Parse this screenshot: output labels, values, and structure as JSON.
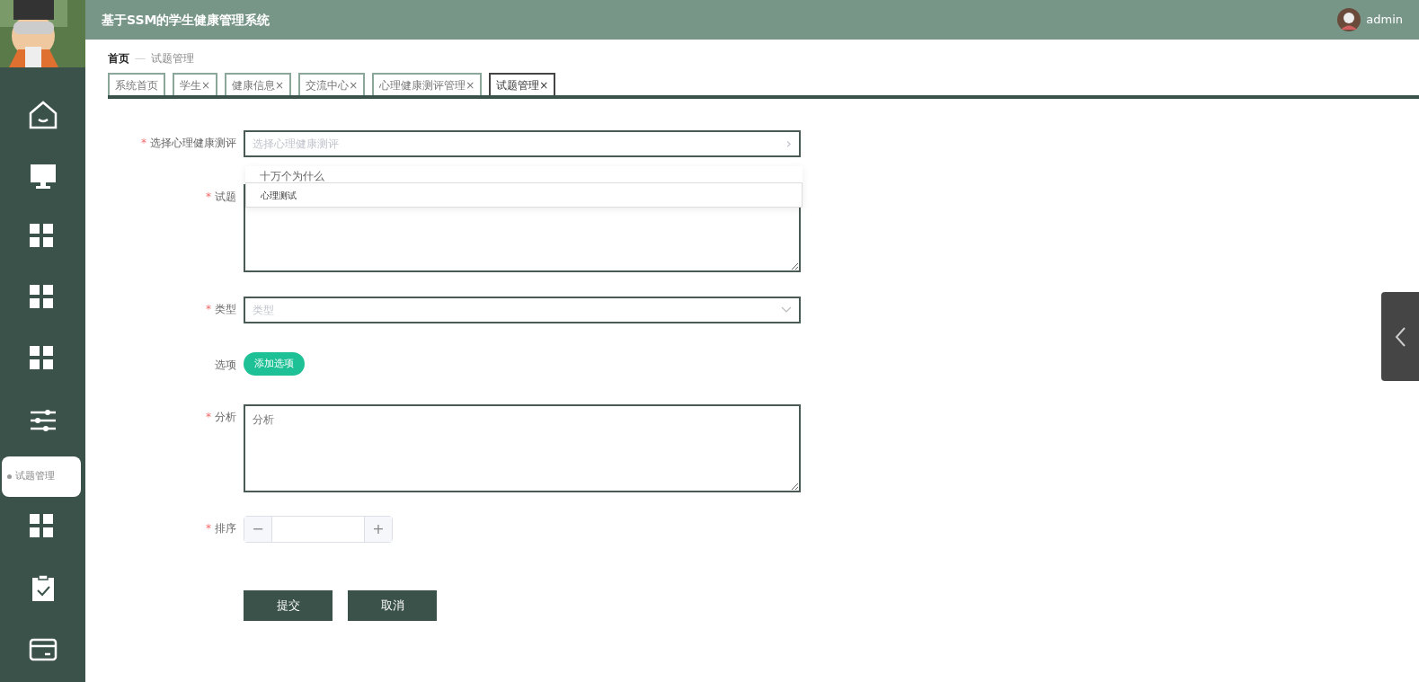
{
  "header": {
    "title": "基于SSM的学生健康管理系统",
    "user": "admin"
  },
  "sidebar": {
    "flyout": "试题管理"
  },
  "breadcrumb": [
    {
      "label": "首页",
      "current": false
    },
    {
      "label": "—",
      "current": false
    },
    {
      "label": "试题管理",
      "current": true
    }
  ],
  "tabs": [
    {
      "label": "系统首页",
      "selected": false
    },
    {
      "label": "学生",
      "close": "×",
      "selected": false
    },
    {
      "label": "健康信息",
      "close": "×",
      "selected": false
    },
    {
      "label": "交流中心",
      "close": "×",
      "selected": false
    },
    {
      "label": "心理健康测评管理",
      "close": "×",
      "selected": false
    },
    {
      "label": "试题管理",
      "close": "×",
      "selected": true
    }
  ],
  "form": {
    "fields": [
      {
        "kind": "cascader",
        "label": "选择心理健康测评",
        "required_mark": "*",
        "placeholder": "选择心理健康测评",
        "arrow": "›",
        "options": [
          {
            "label": "十万个为什么",
            "selected": false
          },
          {
            "label": "心理测试",
            "selected": true
          }
        ]
      },
      {
        "kind": "textarea",
        "label": "试题",
        "required_mark": "*"
      },
      {
        "kind": "select",
        "label": "类型",
        "required_mark": "*",
        "placeholder": "类型"
      },
      {
        "kind": "options",
        "label": "选项",
        "button": "添加选项"
      },
      {
        "kind": "textarea",
        "label": "分析",
        "required_mark": "*",
        "placeholder": "分析"
      },
      {
        "kind": "number",
        "label": "排序",
        "required_mark": "*",
        "minus": "−",
        "plus": "+"
      }
    ],
    "buttons": [
      "提交",
      "取消"
    ]
  }
}
